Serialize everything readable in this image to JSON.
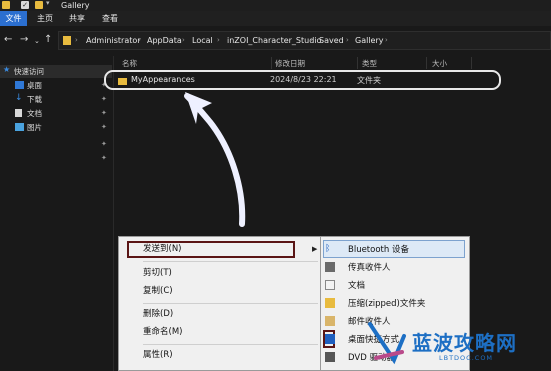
{
  "window": {
    "title": "Gallery"
  },
  "ribbon": {
    "tabs": [
      "文件",
      "主页",
      "共享",
      "查看"
    ]
  },
  "address": {
    "crumbs": [
      "Administrator",
      "AppData",
      "Local",
      "inZOI_Character_Studio",
      "Saved",
      "Gallery"
    ]
  },
  "navpane": {
    "items": [
      {
        "label": "快速访问",
        "icon": "star-icon"
      },
      {
        "label": "桌面",
        "icon": "desktop-icon"
      },
      {
        "label": "下载",
        "icon": "download-icon"
      },
      {
        "label": "文档",
        "icon": "document-icon"
      },
      {
        "label": "图片",
        "icon": "pictures-icon"
      }
    ]
  },
  "columns": {
    "name": "名称",
    "date": "修改日期",
    "type": "类型",
    "size": "大小"
  },
  "file": {
    "name": "MyAppearances",
    "date": "2024/8/23 22:21",
    "type": "文件夹"
  },
  "context_menu": {
    "items": [
      "发送到(N)",
      "剪切(T)",
      "复制(C)",
      "删除(D)",
      "重命名(M)",
      "属性(R)"
    ]
  },
  "sendto_menu": {
    "items": [
      "Bluetooth 设备",
      "传真收件人",
      "文档",
      "压缩(zipped)文件夹",
      "邮件收件人",
      "桌面快捷方式",
      "DVD 驱动器"
    ]
  },
  "watermark": {
    "text": "蓝波攻略网",
    "sub": "LBTDOC.COM"
  },
  "colors": {
    "accent": "#2b6fd0",
    "folder": "#e8bb3f",
    "highlight_border": "#5a1515",
    "watermark": "#1d6fc4"
  }
}
